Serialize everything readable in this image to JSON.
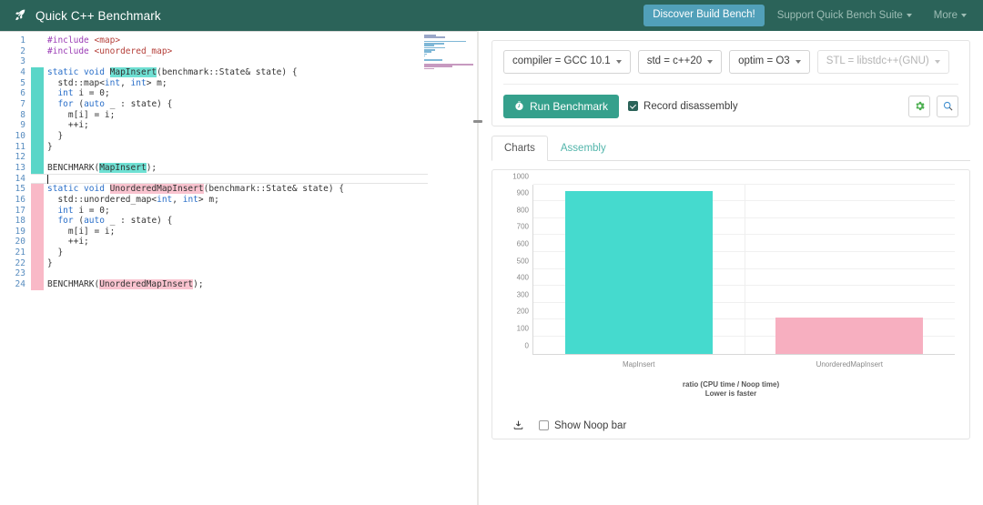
{
  "header": {
    "brand": "Quick C++ Benchmark",
    "brand_icon": "rocket-icon",
    "discover_button": "Discover Build Bench!",
    "nav_links": [
      {
        "label": "Support Quick Bench Suite",
        "has_caret": true
      },
      {
        "label": "More",
        "has_caret": true
      }
    ],
    "bg_color": "#2b6359",
    "discover_color": "#51a0b9"
  },
  "editor": {
    "lines": [
      {
        "n": "1",
        "marker": "",
        "segments": [
          {
            "t": "#include ",
            "c": "pre"
          },
          {
            "t": "<map>",
            "c": "str"
          }
        ]
      },
      {
        "n": "2",
        "marker": "",
        "segments": [
          {
            "t": "#include ",
            "c": "pre"
          },
          {
            "t": "<unordered_map>",
            "c": "str"
          }
        ]
      },
      {
        "n": "3",
        "marker": "",
        "segments": []
      },
      {
        "n": "4",
        "marker": "teal",
        "segments": [
          {
            "t": "static void ",
            "c": "kw"
          },
          {
            "t": "MapInsert",
            "c": "hl-teal"
          },
          {
            "t": "(benchmark::State& state) {",
            "c": ""
          }
        ]
      },
      {
        "n": "5",
        "marker": "teal",
        "segments": [
          {
            "t": "  std::map<",
            "c": ""
          },
          {
            "t": "int",
            "c": "kw"
          },
          {
            "t": ", ",
            "c": ""
          },
          {
            "t": "int",
            "c": "kw"
          },
          {
            "t": "> m;",
            "c": ""
          }
        ]
      },
      {
        "n": "6",
        "marker": "teal",
        "segments": [
          {
            "t": "  ",
            "c": ""
          },
          {
            "t": "int",
            "c": "kw"
          },
          {
            "t": " i = 0;",
            "c": ""
          }
        ]
      },
      {
        "n": "7",
        "marker": "teal",
        "segments": [
          {
            "t": "  ",
            "c": ""
          },
          {
            "t": "for",
            "c": "kw"
          },
          {
            "t": " (",
            "c": ""
          },
          {
            "t": "auto",
            "c": "kw"
          },
          {
            "t": " _ : state) {",
            "c": ""
          }
        ]
      },
      {
        "n": "8",
        "marker": "teal",
        "segments": [
          {
            "t": "    m[i] = i;",
            "c": ""
          }
        ]
      },
      {
        "n": "9",
        "marker": "teal",
        "segments": [
          {
            "t": "    ++i;",
            "c": ""
          }
        ]
      },
      {
        "n": "10",
        "marker": "teal",
        "segments": [
          {
            "t": "  }",
            "c": ""
          }
        ]
      },
      {
        "n": "11",
        "marker": "teal",
        "segments": [
          {
            "t": "}",
            "c": ""
          }
        ]
      },
      {
        "n": "12",
        "marker": "teal",
        "segments": []
      },
      {
        "n": "13",
        "marker": "teal",
        "segments": [
          {
            "t": "BENCHMARK(",
            "c": ""
          },
          {
            "t": "MapInsert",
            "c": "hl-teal"
          },
          {
            "t": ");",
            "c": ""
          }
        ]
      },
      {
        "n": "14",
        "marker": "",
        "segments": [],
        "current": true
      },
      {
        "n": "15",
        "marker": "pink",
        "segments": [
          {
            "t": "static void ",
            "c": "kw"
          },
          {
            "t": "UnorderedMapInsert",
            "c": "hl-pink"
          },
          {
            "t": "(benchmark::State& state) {",
            "c": ""
          }
        ]
      },
      {
        "n": "16",
        "marker": "pink",
        "segments": [
          {
            "t": "  std::unordered_map<",
            "c": ""
          },
          {
            "t": "int",
            "c": "kw"
          },
          {
            "t": ", ",
            "c": ""
          },
          {
            "t": "int",
            "c": "kw"
          },
          {
            "t": "> m;",
            "c": ""
          }
        ]
      },
      {
        "n": "17",
        "marker": "pink",
        "segments": [
          {
            "t": "  ",
            "c": ""
          },
          {
            "t": "int",
            "c": "kw"
          },
          {
            "t": " i = 0;",
            "c": ""
          }
        ]
      },
      {
        "n": "18",
        "marker": "pink",
        "segments": [
          {
            "t": "  ",
            "c": ""
          },
          {
            "t": "for",
            "c": "kw"
          },
          {
            "t": " (",
            "c": ""
          },
          {
            "t": "auto",
            "c": "kw"
          },
          {
            "t": " _ : state) {",
            "c": ""
          }
        ]
      },
      {
        "n": "19",
        "marker": "pink",
        "segments": [
          {
            "t": "    m[i] = i;",
            "c": ""
          }
        ]
      },
      {
        "n": "20",
        "marker": "pink",
        "segments": [
          {
            "t": "    ++i;",
            "c": ""
          }
        ]
      },
      {
        "n": "21",
        "marker": "pink",
        "segments": [
          {
            "t": "  }",
            "c": ""
          }
        ]
      },
      {
        "n": "22",
        "marker": "pink",
        "segments": [
          {
            "t": "}",
            "c": ""
          }
        ]
      },
      {
        "n": "23",
        "marker": "pink",
        "segments": []
      },
      {
        "n": "24",
        "marker": "pink",
        "segments": [
          {
            "t": "BENCHMARK(",
            "c": ""
          },
          {
            "t": "UnorderedMapInsert",
            "c": "hl-pink"
          },
          {
            "t": ");",
            "c": ""
          }
        ]
      }
    ]
  },
  "config": {
    "options": [
      {
        "label": "compiler = GCC 10.1",
        "disabled": false
      },
      {
        "label": "std = c++20",
        "disabled": false
      },
      {
        "label": "optim = O3",
        "disabled": false
      },
      {
        "label": "STL = libstdc++(GNU)",
        "disabled": true
      }
    ],
    "run_button": "Run Benchmark",
    "run_icon": "stopwatch-icon",
    "record_disassembly": {
      "label": "Record disassembly",
      "checked": true
    },
    "icon_buttons": [
      {
        "name": "share-gear-icon",
        "color": "#4caf50"
      },
      {
        "name": "inspect-magnifier-icon",
        "color": "#3f8fd0"
      }
    ]
  },
  "tabs": [
    {
      "label": "Charts",
      "active": true
    },
    {
      "label": "Assembly",
      "active": false
    }
  ],
  "chart_data": {
    "type": "bar",
    "title": "",
    "categories": [
      "MapInsert",
      "UnorderedMapInsert"
    ],
    "values": [
      958,
      212
    ],
    "colors": [
      "#45dace",
      "#f7afc0"
    ],
    "xlabel": "",
    "ylabel": "",
    "ylim": [
      0,
      1000
    ],
    "yticks": [
      0,
      100,
      200,
      300,
      400,
      500,
      600,
      700,
      800,
      900,
      1000
    ],
    "grid": true,
    "legend": "none",
    "caption_line1": "ratio (CPU time / Noop time)",
    "caption_line2": "Lower is faster"
  },
  "chart_footer": {
    "download_icon": "download-icon",
    "show_noop": {
      "label": "Show Noop bar",
      "checked": false
    }
  }
}
